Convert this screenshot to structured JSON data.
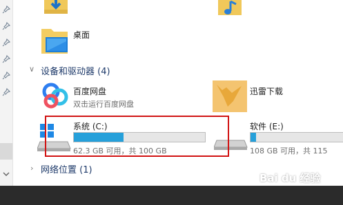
{
  "quick_access": {
    "desktop_label": "桌面"
  },
  "devices_group": {
    "header": "设备和驱动器 (4)",
    "apps": [
      {
        "name": "百度网盘",
        "subtitle": "双击运行百度网盘",
        "icon": "baidu-netdisk-icon"
      },
      {
        "name": "迅雷下载",
        "icon": "xunlei-icon"
      }
    ],
    "drives": [
      {
        "name": "系统 (C:)",
        "info": "62.3 GB 可用，共 100 GB",
        "used_fraction": 0.377,
        "icon": "windows-drive-icon"
      },
      {
        "name": "软件 (E:)",
        "info": "108 GB 可用，共 115",
        "used_fraction": 0.06,
        "icon": "drive-icon"
      }
    ]
  },
  "network_group": {
    "header": "网络位置 (1)"
  },
  "watermark": "Bai du 经验",
  "colors": {
    "progress": "#26a0da",
    "highlight": "#d11212",
    "group_header": "#1e3a6a"
  }
}
